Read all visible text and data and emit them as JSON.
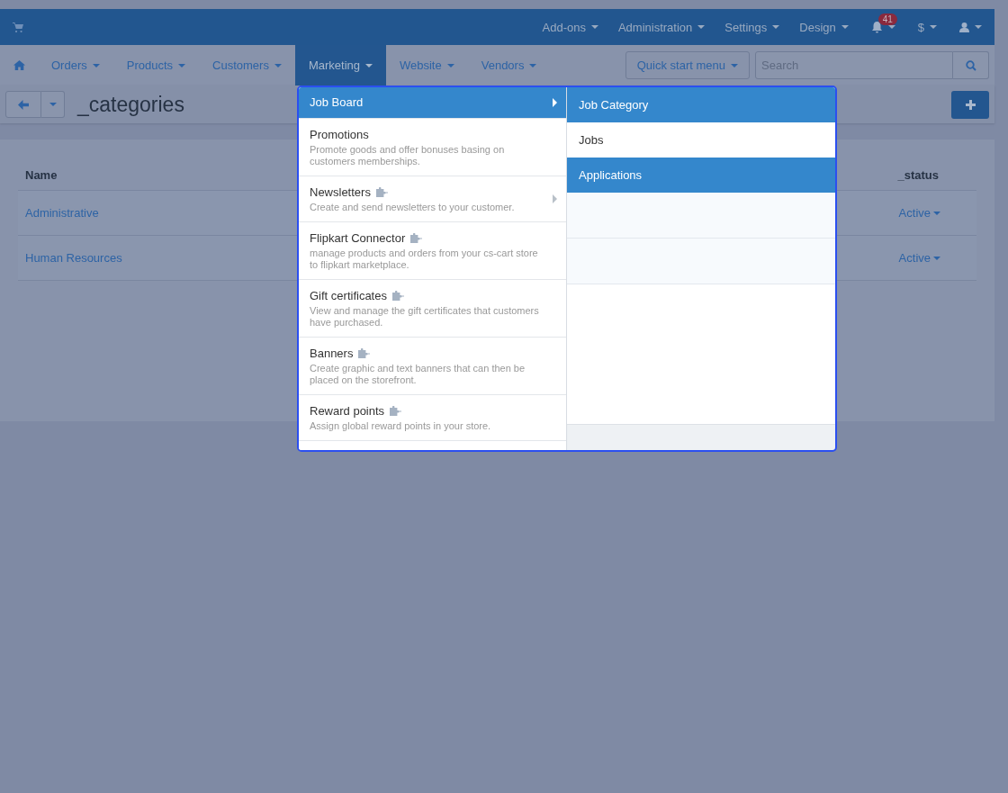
{
  "top_bar": {
    "menus": [
      {
        "label": "Add-ons"
      },
      {
        "label": "Administration"
      },
      {
        "label": "Settings"
      },
      {
        "label": "Design"
      }
    ],
    "notification_count": "41",
    "currency": "$"
  },
  "nav": {
    "items": [
      {
        "label": "Orders",
        "selected": false
      },
      {
        "label": "Products",
        "selected": false
      },
      {
        "label": "Customers",
        "selected": false
      },
      {
        "label": "Marketing",
        "selected": true
      },
      {
        "label": "Website",
        "selected": false
      },
      {
        "label": "Vendors",
        "selected": false
      }
    ],
    "quick_start": "Quick start menu",
    "search": {
      "placeholder": "Search"
    }
  },
  "page": {
    "title": "_categories"
  },
  "table": {
    "columns": [
      "Name",
      "_status"
    ],
    "rows": [
      {
        "name": "Administrative",
        "status": "Active"
      },
      {
        "name": "Human Resources",
        "status": "Active"
      }
    ]
  },
  "dropdown": {
    "items": [
      {
        "title": "Job Board",
        "selected": true,
        "submenu": true,
        "addon": false
      },
      {
        "title": "Promotions",
        "description": "Promote goods and offer bonuses basing on customers memberships.",
        "selected": false,
        "submenu": false,
        "addon": false
      },
      {
        "title": "Newsletters",
        "description": "Create and send newsletters to your customer.",
        "selected": false,
        "submenu": true,
        "addon": true
      },
      {
        "title": "Flipkart Connector",
        "description": "manage products and orders from your cs-cart store to flipkart marketplace.",
        "selected": false,
        "submenu": false,
        "addon": true
      },
      {
        "title": "Gift certificates",
        "description": "View and manage the gift certificates that customers have purchased.",
        "selected": false,
        "submenu": false,
        "addon": true
      },
      {
        "title": "Banners",
        "description": "Create graphic and text banners that can then be placed on the storefront.",
        "selected": false,
        "submenu": false,
        "addon": true
      },
      {
        "title": "Reward points",
        "description": "Assign global reward points in your store.",
        "selected": false,
        "submenu": false,
        "addon": true
      }
    ],
    "submenu_items": [
      {
        "label": "Job Category",
        "selected": true
      },
      {
        "label": "Jobs",
        "selected": false
      },
      {
        "label": "Applications",
        "selected": true
      }
    ]
  }
}
